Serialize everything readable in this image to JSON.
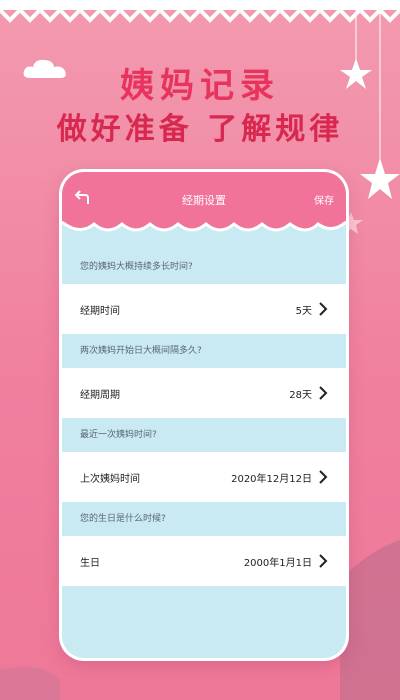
{
  "headline": {
    "title": "姨妈记录",
    "subtitle": "做好准备 了解规律"
  },
  "app": {
    "title": "经期设置",
    "save_label": "保存",
    "back_icon": "back-arrow-icon"
  },
  "settings": [
    {
      "question": "您的姨妈大概持续多长时间?",
      "label": "经期时间",
      "value": "5天"
    },
    {
      "question": "两次姨妈开始日大概间隔多久?",
      "label": "经期周期",
      "value": "28天"
    },
    {
      "question": "最近一次姨妈时间?",
      "label": "上次姨妈时间",
      "value": "2020年12月12日"
    },
    {
      "question": "您的生日是什么时候?",
      "label": "生日",
      "value": "2000年1月1日"
    }
  ],
  "colors": {
    "background": "#f39ab0",
    "headline": "#e8335c",
    "appbar": "#f2739a",
    "section_bg": "#c9eaf3"
  }
}
